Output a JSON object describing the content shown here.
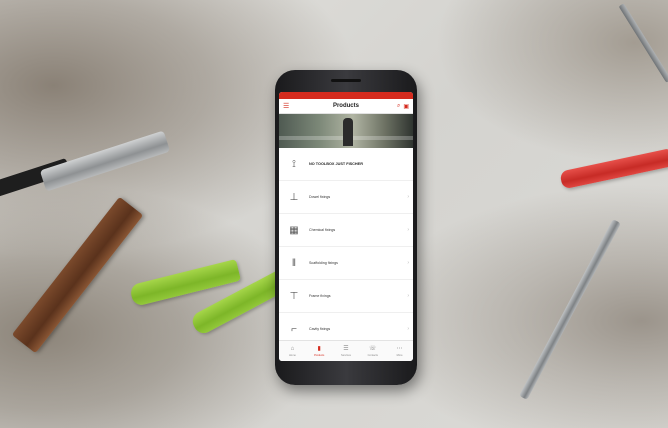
{
  "app": {
    "title": "Products",
    "accent": "#d52b1e",
    "menu_icon": "hamburger-icon",
    "actions": [
      {
        "name": "search-icon",
        "glyph": "⌕"
      },
      {
        "name": "cart-icon",
        "glyph": "▣"
      }
    ]
  },
  "products": [
    {
      "label": "NO TOOLBOX JUST FISCHER",
      "icon": "wall-plug-icon",
      "glyph": "⟟"
    },
    {
      "label": "Dowel fixings",
      "icon": "dowel-icon",
      "glyph": "⊥"
    },
    {
      "label": "Chemical fixings",
      "icon": "chemical-icon",
      "glyph": "▦"
    },
    {
      "label": "Scaffolding fixings",
      "icon": "scaffold-icon",
      "glyph": "‖"
    },
    {
      "label": "Frame fixings",
      "icon": "frame-icon",
      "glyph": "⊤"
    },
    {
      "label": "Cavity fixings",
      "icon": "cavity-icon",
      "glyph": "⌐"
    }
  ],
  "bottom_nav": [
    {
      "label": "Home",
      "icon": "home-icon",
      "glyph": "⌂",
      "active": false
    },
    {
      "label": "Products",
      "icon": "products-icon",
      "glyph": "▮",
      "active": true
    },
    {
      "label": "Services",
      "icon": "services-icon",
      "glyph": "☰",
      "active": false
    },
    {
      "label": "Contacts",
      "icon": "contacts-icon",
      "glyph": "☏",
      "active": false
    },
    {
      "label": "More",
      "icon": "more-icon",
      "glyph": "⋯",
      "active": false
    }
  ]
}
